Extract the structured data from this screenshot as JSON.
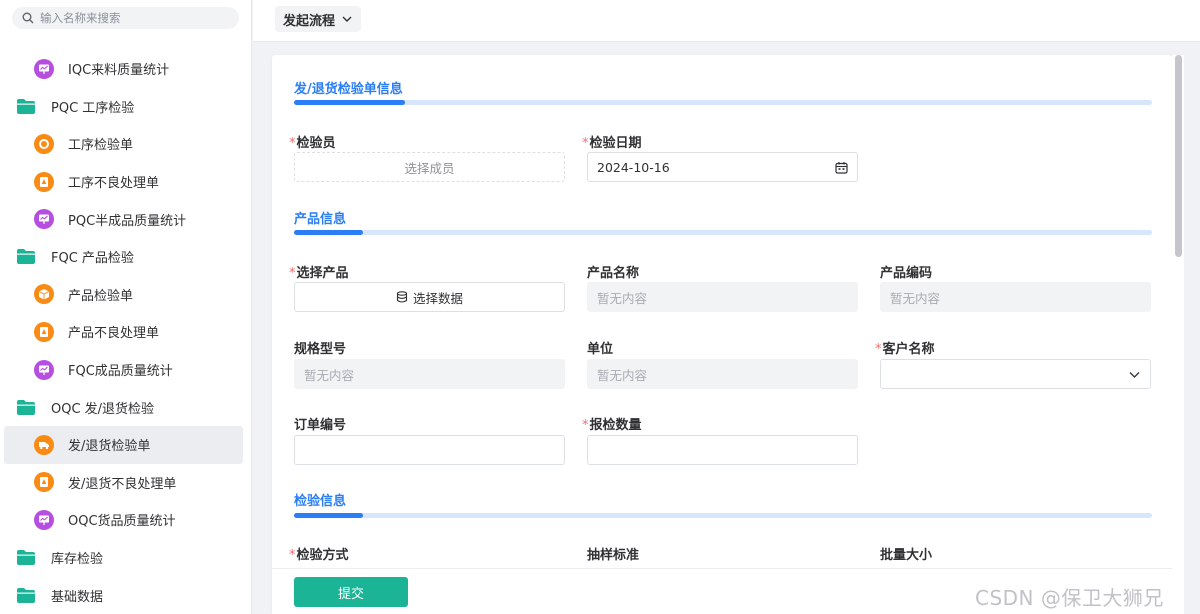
{
  "search": {
    "placeholder": "输入名称来搜索"
  },
  "sidebar": {
    "items": [
      {
        "label": "IQC来料质量统计"
      },
      {
        "label": "PQC 工序检验"
      },
      {
        "label": "工序检验单"
      },
      {
        "label": "工序不良处理单"
      },
      {
        "label": "PQC半成品质量统计"
      },
      {
        "label": "FQC 产品检验"
      },
      {
        "label": "产品检验单"
      },
      {
        "label": "产品不良处理单"
      },
      {
        "label": "FQC成品质量统计"
      },
      {
        "label": "OQC 发/退货检验"
      },
      {
        "label": "发/退货检验单"
      },
      {
        "label": "发/退货不良处理单"
      },
      {
        "label": "OQC货品质量统计"
      },
      {
        "label": "库存检验"
      },
      {
        "label": "基础数据"
      }
    ]
  },
  "topbar": {
    "launch_label": "发起流程"
  },
  "form": {
    "sections": [
      {
        "title": "发/退货检验单信息"
      },
      {
        "title": "产品信息"
      },
      {
        "title": "检验信息"
      }
    ],
    "inspector": {
      "label": "检验员",
      "placeholder": "选择成员"
    },
    "inspect_date": {
      "label": "检验日期",
      "value": "2024-10-16"
    },
    "select_product": {
      "label": "选择产品",
      "button": "选择数据"
    },
    "product_name": {
      "label": "产品名称",
      "value": "暂无内容"
    },
    "product_code": {
      "label": "产品编码",
      "value": "暂无内容"
    },
    "spec_model": {
      "label": "规格型号",
      "value": "暂无内容"
    },
    "unit": {
      "label": "单位",
      "value": "暂无内容"
    },
    "customer_name": {
      "label": "客户名称",
      "value": ""
    },
    "order_no": {
      "label": "订单编号",
      "value": ""
    },
    "inspect_qty": {
      "label": "报检数量",
      "value": ""
    },
    "inspect_method": {
      "label": "检验方式"
    },
    "sampling_std": {
      "label": "抽样标准"
    },
    "batch_size": {
      "label": "批量大小"
    },
    "required_mark": "*"
  },
  "footer": {
    "submit_label": "提交"
  },
  "watermark": "CSDN @保卫大狮兄",
  "colors": {
    "accent": "#2c7ef6",
    "submit": "#1cb497",
    "required": "#f56c6c",
    "icon_orange": "#f98a14",
    "icon_purple": "#b64fe0",
    "folder": "#1cb497"
  }
}
